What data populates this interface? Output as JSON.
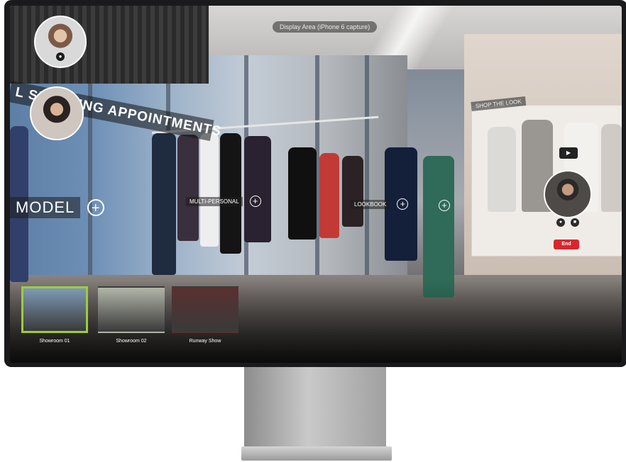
{
  "view": {
    "title_pill": "Display Area (iPhone 6 capture)",
    "banner": "L SHOPPING APPOINTMENTS"
  },
  "participants": {
    "host_mic_icon": "mic-icon",
    "video_call": {
      "end_label": "End",
      "play_icon": "play-icon",
      "panel_label": "SHOP THE LOOK"
    }
  },
  "hotspots": {
    "model": {
      "label": "MODEL",
      "icon": "plus-circle-icon"
    },
    "multi": {
      "label": "MULTI-PERSONAL",
      "icon": "plus-circle-icon"
    },
    "lookbook": {
      "label": "LOOKBOOK",
      "icon": "plus-circle-icon"
    }
  },
  "thumbnails": [
    {
      "label": "Showroom 01",
      "active": true,
      "color": "#7e9ab5"
    },
    {
      "label": "Showroom 02",
      "active": false,
      "color": "#b2b6a8"
    },
    {
      "label": "Runway Show",
      "active": false,
      "color": "#5a3030"
    }
  ],
  "colors": {
    "accent_active": "#9ccc3c",
    "end_call": "#d9262c"
  }
}
